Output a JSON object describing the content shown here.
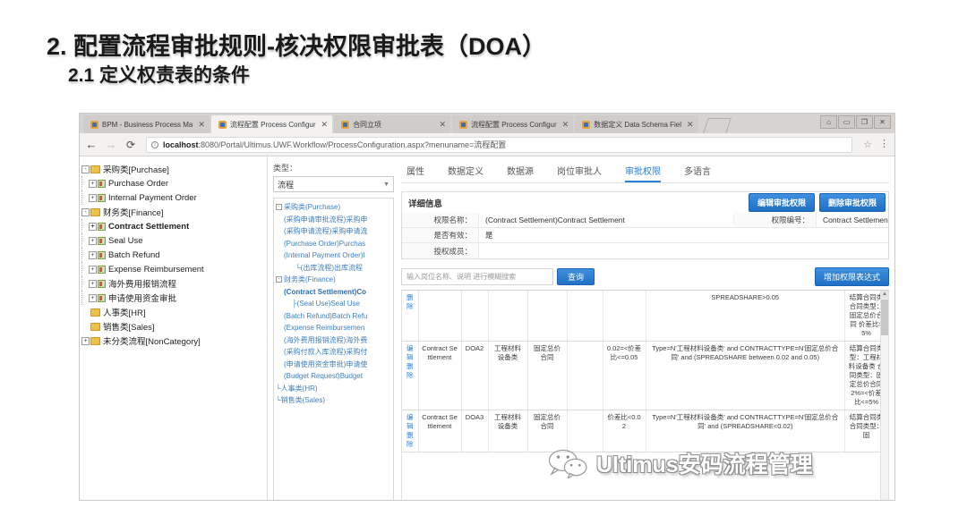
{
  "slide": {
    "title": "2. 配置流程审批规则-核决权限审批表（DOA）",
    "subtitle": "2.1 定义权责表的条件"
  },
  "browser": {
    "tabs": [
      {
        "label": "BPM - Business Process Ma",
        "close": "✕",
        "active": false
      },
      {
        "label": "流程配置 Process Configur",
        "close": "✕",
        "active": true
      },
      {
        "label": "合同立项",
        "close": "✕",
        "active": false
      },
      {
        "label": "流程配置 Process Configur",
        "close": "✕",
        "active": false
      },
      {
        "label": "数据定义 Data Schema Fiel",
        "close": "✕",
        "active": false
      }
    ],
    "window_controls": [
      "⌂",
      "▭",
      "❐",
      "✕"
    ],
    "nav": {
      "back": "←",
      "forward": "→",
      "reload": "⟳",
      "info": "ⓘ",
      "host": "localhost",
      "url_rest": ":8080/Portal/Ultimus.UWF.Workflow/ProcessConfiguration.aspx?menuname=流程配置",
      "star": "☆",
      "menu": "⋮"
    }
  },
  "left_tree": [
    {
      "indent": 0,
      "expander": "-",
      "icon": "folder",
      "label": "采购类[Purchase]",
      "bold": false
    },
    {
      "indent": 1,
      "expander": "+",
      "icon": "process",
      "label": "Purchase Order",
      "bold": false
    },
    {
      "indent": 1,
      "expander": "+",
      "icon": "process",
      "label": "Internal Payment Order",
      "bold": false
    },
    {
      "indent": 0,
      "expander": "-",
      "icon": "folder",
      "label": "财务类[Finance]",
      "bold": false
    },
    {
      "indent": 1,
      "expander": "+",
      "icon": "process",
      "label": "Contract Settlement",
      "bold": true
    },
    {
      "indent": 1,
      "expander": "+",
      "icon": "process",
      "label": "Seal Use",
      "bold": false
    },
    {
      "indent": 1,
      "expander": "+",
      "icon": "process",
      "label": "Batch Refund",
      "bold": false
    },
    {
      "indent": 1,
      "expander": "+",
      "icon": "process",
      "label": "Expense Reimbursement",
      "bold": false
    },
    {
      "indent": 1,
      "expander": "+",
      "icon": "process",
      "label": "海外费用报销流程",
      "bold": false
    },
    {
      "indent": 1,
      "expander": "+",
      "icon": "process",
      "label": "申请使用资金审批",
      "bold": false
    },
    {
      "indent": 0,
      "expander": "",
      "icon": "folder",
      "label": "人事类[HR]",
      "bold": false
    },
    {
      "indent": 0,
      "expander": "",
      "icon": "folder",
      "label": "销售类[Sales]",
      "bold": false
    },
    {
      "indent": 0,
      "expander": "+",
      "icon": "folder",
      "label": "未分类流程[NonCategory]",
      "bold": false
    }
  ],
  "content_tabs": [
    {
      "label": "属性",
      "active": false
    },
    {
      "label": "数据定义",
      "active": false
    },
    {
      "label": "数据源",
      "active": false
    },
    {
      "label": "岗位审批人",
      "active": false
    },
    {
      "label": "审批权限",
      "active": true
    },
    {
      "label": "多语言",
      "active": false
    }
  ],
  "type_selector": {
    "label": "类型：",
    "value": "流程",
    "caret": "▼"
  },
  "mid_tree": [
    {
      "indent": 0,
      "expander": "-",
      "label": "采购类(Purchase)",
      "bold": false
    },
    {
      "indent": 1,
      "expander": "",
      "label": "(采购申请审批流程)采购申",
      "bold": false
    },
    {
      "indent": 1,
      "expander": "",
      "label": "(采购申请流程)采购申请流",
      "bold": false
    },
    {
      "indent": 1,
      "expander": "",
      "label": "(Purchase Order)Purchas",
      "bold": false
    },
    {
      "indent": 1,
      "expander": "",
      "label": "(Internal Payment Order)I",
      "bold": false
    },
    {
      "indent": 2,
      "expander": "",
      "label": "└(出库流程)出库流程",
      "bold": false
    },
    {
      "indent": 0,
      "expander": "-",
      "label": "财务类(Finance)",
      "bold": false
    },
    {
      "indent": 1,
      "expander": "",
      "label": "(Contract Settlement)Co",
      "bold": true
    },
    {
      "indent": 2,
      "expander": "",
      "label": "├(Seal Use)Seal Use",
      "bold": false
    },
    {
      "indent": 1,
      "expander": "",
      "label": "(Batch Refund)Batch Refu",
      "bold": false
    },
    {
      "indent": 1,
      "expander": "",
      "label": "(Expense Reimbursemen",
      "bold": false
    },
    {
      "indent": 1,
      "expander": "",
      "label": "(海外费用报销流程)海外费",
      "bold": false
    },
    {
      "indent": 1,
      "expander": "",
      "label": "(采购付款入库流程)采购付",
      "bold": false
    },
    {
      "indent": 1,
      "expander": "",
      "label": "(申请使用资金审批)申请使",
      "bold": false
    },
    {
      "indent": 1,
      "expander": "",
      "label": "(Budget Request)Budget",
      "bold": false
    },
    {
      "indent": 0,
      "expander": "",
      "label": "└人事类(HR)",
      "bold": false
    },
    {
      "indent": 0,
      "expander": "",
      "label": "└销售类(Sales)",
      "bold": false
    }
  ],
  "detail": {
    "header": "详细信息",
    "edit_button": "编辑审批权限",
    "delete_button": "删除审批权限",
    "fields": {
      "name_label": "权限名称：",
      "name_value": "(Contract Settlement)Contract Settlement",
      "code_label": "权限编号：",
      "code_value": "Contract Settlement",
      "valid_label": "是否有效：",
      "valid_value": "是",
      "members_label": "授权成员：",
      "members_value": ""
    }
  },
  "search": {
    "placeholder": "输入岗位名称、说明 进行模糊搜索",
    "value": "",
    "query_button": "查询",
    "add_button": "增加权限表达式"
  },
  "grid": {
    "actions": [
      "编",
      "辑",
      "删",
      "除"
    ],
    "actions_partial": [
      "删",
      "除"
    ],
    "rows": [
      {
        "actions_partial": true,
        "process": "",
        "code": "",
        "category": "",
        "contract_type": "",
        "blank": "",
        "range": "",
        "expression": "SPREADSHARE>0.05",
        "description": "结算合同类 合同类型：固定总价合同 价差比>5%"
      },
      {
        "actions_partial": false,
        "process": "Contract Settlement",
        "code": "DOA2",
        "category": "工程材料设备类",
        "contract_type": "固定总价合同",
        "blank": "",
        "range": "0.02=<价差比<=0.05",
        "expression": "Type=N'工程材料设备类' and CONTRACTTYPE=N'固定总价合同' and (SPREADSHARE between 0.02 and 0.05)",
        "description": "结算合同类型：工程材料设备类 合同类型：固定总价合同 2%=<价差比<=5%"
      },
      {
        "actions_partial": false,
        "process": "Contract Settlement",
        "code": "DOA3",
        "category": "工程材料设备类",
        "contract_type": "固定总价合同",
        "blank": "",
        "range": "价差比<0.02",
        "expression": "Type=N'工程材料设备类' and CONTRACTTYPE=N'固定总价合同' and (SPREADSHARE<0.02)",
        "description": "结算合同类 合同类型：固"
      }
    ],
    "scroll_up": "▲"
  },
  "watermark": {
    "text": "Ultimus安码流程管理"
  }
}
